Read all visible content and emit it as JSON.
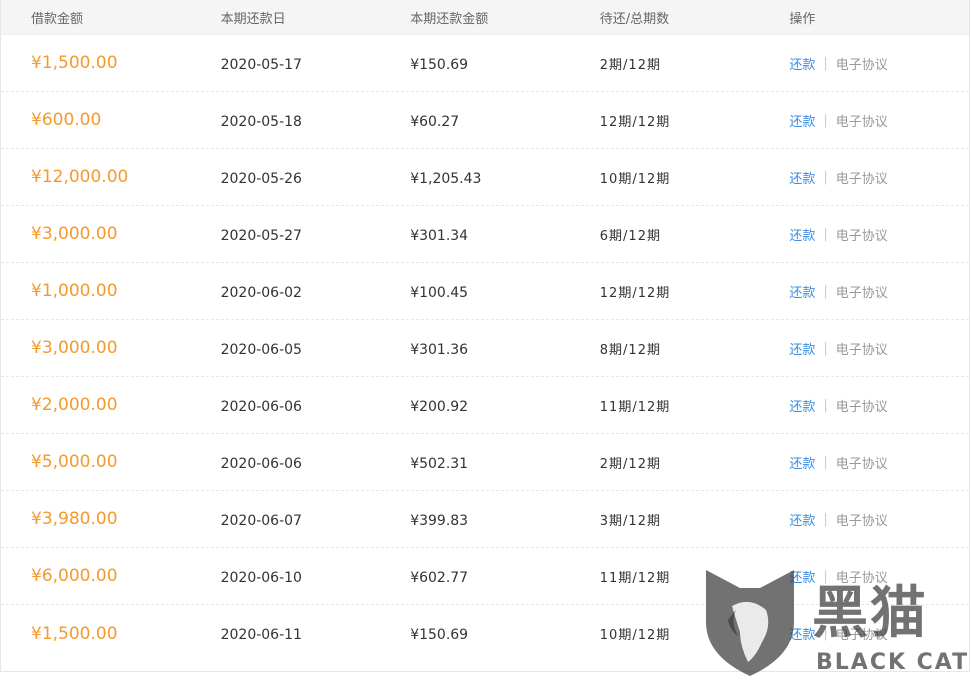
{
  "table": {
    "headers": {
      "amount": "借款金额",
      "date": "本期还款日",
      "pay": "本期还款金额",
      "period": "待还/总期数",
      "ops": "操作"
    },
    "rows": [
      {
        "amount": "¥1,500.00",
        "date": "2020-05-17",
        "pay": "¥150.69",
        "period": "2期/12期"
      },
      {
        "amount": "¥600.00",
        "date": "2020-05-18",
        "pay": "¥60.27",
        "period": "12期/12期"
      },
      {
        "amount": "¥12,000.00",
        "date": "2020-05-26",
        "pay": "¥1,205.43",
        "period": "10期/12期"
      },
      {
        "amount": "¥3,000.00",
        "date": "2020-05-27",
        "pay": "¥301.34",
        "period": "6期/12期"
      },
      {
        "amount": "¥1,000.00",
        "date": "2020-06-02",
        "pay": "¥100.45",
        "period": "12期/12期"
      },
      {
        "amount": "¥3,000.00",
        "date": "2020-06-05",
        "pay": "¥301.36",
        "period": "8期/12期"
      },
      {
        "amount": "¥2,000.00",
        "date": "2020-06-06",
        "pay": "¥200.92",
        "period": "11期/12期"
      },
      {
        "amount": "¥5,000.00",
        "date": "2020-06-06",
        "pay": "¥502.31",
        "period": "2期/12期"
      },
      {
        "amount": "¥3,980.00",
        "date": "2020-06-07",
        "pay": "¥399.83",
        "period": "3期/12期"
      },
      {
        "amount": "¥6,000.00",
        "date": "2020-06-10",
        "pay": "¥602.77",
        "period": "11期/12期"
      },
      {
        "amount": "¥1,500.00",
        "date": "2020-06-11",
        "pay": "¥150.69",
        "period": "10期/12期"
      }
    ],
    "actions": {
      "pay_label": "还款",
      "agreement_label": "电子协议"
    }
  },
  "colors": {
    "amount": "#f39a2e",
    "link": "#3a8ee6",
    "muted_link": "#999999"
  },
  "watermark": {
    "title": "黑猫",
    "subtitle": "BLACK CAT",
    "icon": "cat-shield-icon"
  }
}
